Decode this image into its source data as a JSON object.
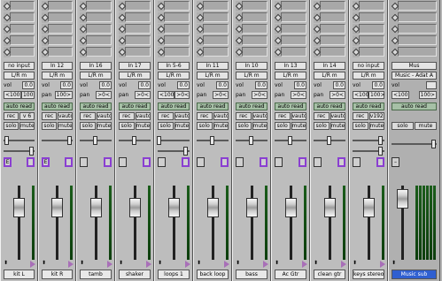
{
  "channels": [
    {
      "io": "no input",
      "output": "L/R m",
      "vol": "0.0",
      "pan_l": "<100",
      "pan_r": "",
      "pan_single": "100",
      "auto": "auto read",
      "rec": "rec",
      "rec_extra": "v 6",
      "solo": "solo",
      "mute": "mute",
      "vbox_l": "E",
      "vbox_r": "",
      "name": "kit L"
    },
    {
      "io": "In 12",
      "output": "L/R m",
      "vol": "0.0",
      "pan_single": "100>",
      "auto": "auto read",
      "rec": "rec",
      "rec_extra": "vauto",
      "solo": "solo",
      "mute": "mute",
      "vbox_l": "E",
      "vbox_r": "",
      "name": "kit R"
    },
    {
      "io": "In 16",
      "output": "L/R m",
      "vol": "0.0",
      "pan_single": ">0<",
      "auto": "auto read",
      "rec": "rec",
      "rec_extra": "vauto",
      "solo": "solo",
      "mute": "mute",
      "vbox_l": "",
      "vbox_r": "",
      "name": "tamb"
    },
    {
      "io": "In 17",
      "output": "L/R m",
      "vol": "0.0",
      "pan_single": ">0<",
      "auto": "auto read",
      "rec": "rec",
      "rec_extra": "vauto",
      "solo": "solo",
      "mute": "mute",
      "vbox_l": "",
      "vbox_r": "",
      "name": "shaker"
    },
    {
      "io": "In 5-6",
      "output": "L/R m",
      "vol": "0.0",
      "pan_l": "<100",
      "pan_single": ">0<",
      "auto": "auto read",
      "rec": "rec",
      "rec_extra": "vauto",
      "solo": "solo",
      "mute": "mute",
      "vbox_l": "",
      "vbox_r": "",
      "name": "loops 1"
    },
    {
      "io": "In 11",
      "output": "L/R m",
      "vol": "0.0",
      "pan_single": ">0<",
      "auto": "auto read",
      "rec": "rec",
      "rec_extra": "vauto",
      "solo": "solo",
      "mute": "mute",
      "vbox_l": "",
      "vbox_r": "",
      "name": "back loop"
    },
    {
      "io": "In 10",
      "output": "L/R m",
      "vol": "0.0",
      "pan_single": ">0<",
      "auto": "auto read",
      "rec": "rec",
      "rec_extra": "vauto",
      "solo": "solo",
      "mute": "mute",
      "vbox_l": "",
      "vbox_r": "",
      "name": "bass"
    },
    {
      "io": "In 13",
      "output": "L/R m",
      "vol": "0.0",
      "pan_single": ">0<",
      "auto": "auto read",
      "rec": "rec",
      "rec_extra": "vauto",
      "solo": "solo",
      "mute": "mute",
      "vbox_l": "",
      "vbox_r": "",
      "name": "Ac Gtr"
    },
    {
      "io": "In 14",
      "output": "L/R m",
      "vol": "0.0",
      "pan_single": ">0<",
      "auto": "auto read",
      "rec": "rec",
      "rec_extra": "vauto",
      "solo": "solo",
      "mute": "mute",
      "vbox_l": "",
      "vbox_r": "",
      "name": "clean gtr"
    },
    {
      "io": "no input",
      "output": "L/R m",
      "vol": "0.0",
      "pan_l": "<100",
      "pan_single": "100>",
      "auto": "auto read",
      "rec": "rec",
      "rec_extra": "v192",
      "solo": "solo",
      "mute": "mute",
      "vbox_l": "",
      "vbox_r": "",
      "name": "keys stereo"
    }
  ],
  "bus": {
    "io": "Mus",
    "output": "Music - Adat A",
    "vol": "",
    "auto": "auto read",
    "solo": "solo",
    "mute": "mute",
    "name": "Music sub"
  }
}
